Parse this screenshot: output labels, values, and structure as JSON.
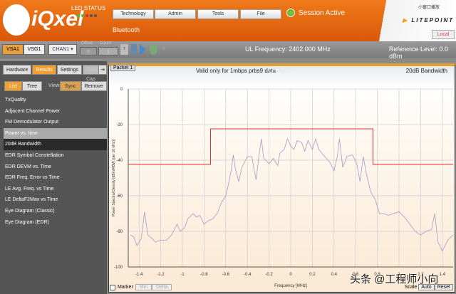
{
  "header": {
    "logo": "iQxel",
    "led_status": "LED STATUS",
    "buttons": [
      "Technology",
      "Admin",
      "Tools",
      "File"
    ],
    "subtitle": "Bluetooth",
    "session": "Session Active",
    "brand": "LITEPOINT",
    "local": "Local",
    "overlay": "小窗口播放"
  },
  "toolbar": {
    "vsa": "VSA1",
    "vsg": "VSG1",
    "chan": "CHAN1",
    "offset_label": "Offset",
    "offset_value": "0",
    "count_label": "Count",
    "count_value": "1",
    "ul_freq": "UL Frequency: 2402.000 MHz",
    "ref_level": "Reference Level: 0.0 dBm"
  },
  "left": {
    "tabs": [
      "Hardware",
      "Results",
      "Settings",
      "Data Cap"
    ],
    "list_btn": "List",
    "tree_btn": "Tree",
    "view_label": "View:",
    "sync_btn": "Sync",
    "remove_btn": "Remove",
    "items": [
      "TxQuality",
      "Adjacent Channel Power",
      "FM Demodulator Output",
      "Power vs. time",
      "20dB Bandwidth",
      "EDR Symbol Constellation",
      "EDR DEVM vs. Time",
      "EDR Freq. Error vs Time",
      "LE Avg. Freq. vs Time",
      "LE DeltaF2Max vs Time",
      "Eye Diagram (Classic)",
      "Eye Diagram (EDR)"
    ]
  },
  "chart_panel": {
    "packet_tab": "Packet 1",
    "note": "Valid only for 1mbps prbs9 data",
    "watermark": "CHAN1",
    "title": "20dB Bandwidth",
    "marker": "Marker",
    "min": "Min",
    "delta": "Delta",
    "scale": "Scale",
    "auto": "Auto",
    "reset": "Reset",
    "credit": "头条 @工程师小向"
  },
  "chart_data": {
    "type": "line",
    "title": "20dB Bandwidth",
    "xlabel": "Frequency [MHz]",
    "ylabel": "Power Spectral Density [dBm/RBW (per 10 kHz)]",
    "xlim": [
      -1.5,
      1.5
    ],
    "ylim": [
      -100,
      0
    ],
    "xticks": [
      "-1.4",
      "-1.2",
      "-1",
      "-0.8",
      "-0.6",
      "-0.4",
      "-0.2",
      "0",
      "0.2",
      "0.4",
      "0.6",
      "0.8",
      "1",
      "1.2",
      "1.4"
    ],
    "yticks": [
      "0",
      "-20",
      "-40",
      "-60",
      "-80",
      "-100"
    ],
    "grid": true,
    "colors": {
      "trace": "#a898c8",
      "mask": "#e03030"
    },
    "mask": {
      "x": [
        -1.5,
        -0.74,
        -0.74,
        0.76,
        0.76,
        1.5
      ],
      "y": [
        -42.4,
        -42.4,
        -22.4,
        -22.4,
        -42.4,
        -42.4
      ]
    },
    "trace": {
      "x": [
        -1.48,
        -1.45,
        -1.42,
        -1.38,
        -1.35,
        -1.32,
        -1.28,
        -1.25,
        -1.2,
        -1.15,
        -1.1,
        -1.05,
        -1.02,
        -0.98,
        -0.95,
        -0.9,
        -0.87,
        -0.84,
        -0.8,
        -0.76,
        -0.72,
        -0.68,
        -0.64,
        -0.6,
        -0.58,
        -0.55,
        -0.53,
        -0.51,
        -0.48,
        -0.45,
        -0.4,
        -0.36,
        -0.32,
        -0.29,
        -0.27,
        -0.25,
        -0.2,
        -0.16,
        -0.12,
        -0.1,
        -0.06,
        -0.03,
        0,
        0.03,
        0.06,
        0.1,
        0.13,
        0.16,
        0.2,
        0.23,
        0.26,
        0.3,
        0.33,
        0.36,
        0.4,
        0.43,
        0.45,
        0.48,
        0.52,
        0.57,
        0.61,
        0.64,
        0.67,
        0.7,
        0.74,
        0.78,
        0.82,
        0.86,
        0.9,
        0.95,
        1.0,
        1.05,
        1.1,
        1.15,
        1.2,
        1.25,
        1.3,
        1.33,
        1.36,
        1.4,
        1.45,
        1.5
      ],
      "y": [
        -82,
        -83,
        -88,
        -84,
        -69,
        -82,
        -84,
        -86,
        -85,
        -85,
        -82,
        -76,
        -80,
        -78,
        -73,
        -70,
        -72,
        -71,
        -76,
        -74,
        -73,
        -70,
        -64,
        -60,
        -55,
        -46,
        -37,
        -45,
        -52,
        -44,
        -38,
        -38,
        -51,
        -36,
        -28,
        -39,
        -42,
        -39,
        -43,
        -36,
        -34,
        -28,
        -32,
        -34,
        -29,
        -30,
        -35,
        -29,
        -34,
        -28,
        -34,
        -37,
        -39,
        -41,
        -46,
        -38,
        -28,
        -44,
        -38,
        -37,
        -42,
        -52,
        -38,
        -48,
        -58,
        -62,
        -70,
        -70,
        -71,
        -70,
        -69,
        -72,
        -76,
        -80,
        -82,
        -80,
        -79,
        -70,
        -86,
        -91,
        -85,
        -82
      ]
    }
  }
}
